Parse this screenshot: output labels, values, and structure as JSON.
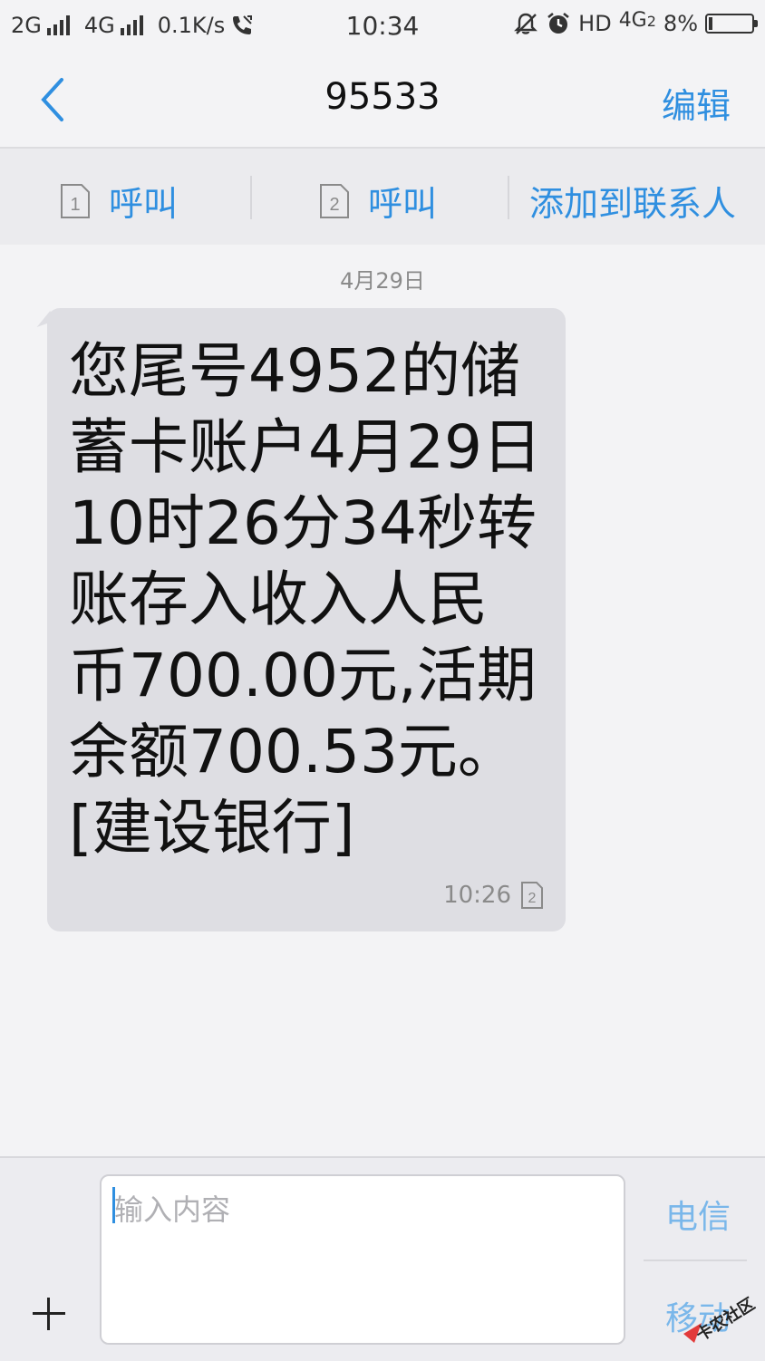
{
  "status_bar": {
    "network1": "2G",
    "network2": "4G",
    "speed": "0.1K/s",
    "time": "10:34",
    "hd": "HD",
    "lte": "4G",
    "sim_slot": "2",
    "battery": "8%",
    "battery_level": 0.08
  },
  "nav": {
    "title": "95533",
    "edit_label": "编辑"
  },
  "actions": {
    "call1_label": "呼叫",
    "sim1": "1",
    "call2_label": "呼叫",
    "sim2": "2",
    "add_contact_label": "添加到联系人"
  },
  "conversation": {
    "date": "4月29日",
    "message": {
      "text": "您尾号4952的储蓄卡账户4月29日10时26分34秒转账存入收入人民币700.00元,活期余额700.53元。[建设银行]",
      "time": "10:26",
      "sim": "2"
    }
  },
  "composer": {
    "placeholder": "输入内容",
    "send_sim1": "电信",
    "send_sim2": "移动"
  },
  "colors": {
    "accent": "#2f8fe0",
    "bubble": "#dedee3"
  },
  "watermark": {
    "text": "卡农社区"
  }
}
